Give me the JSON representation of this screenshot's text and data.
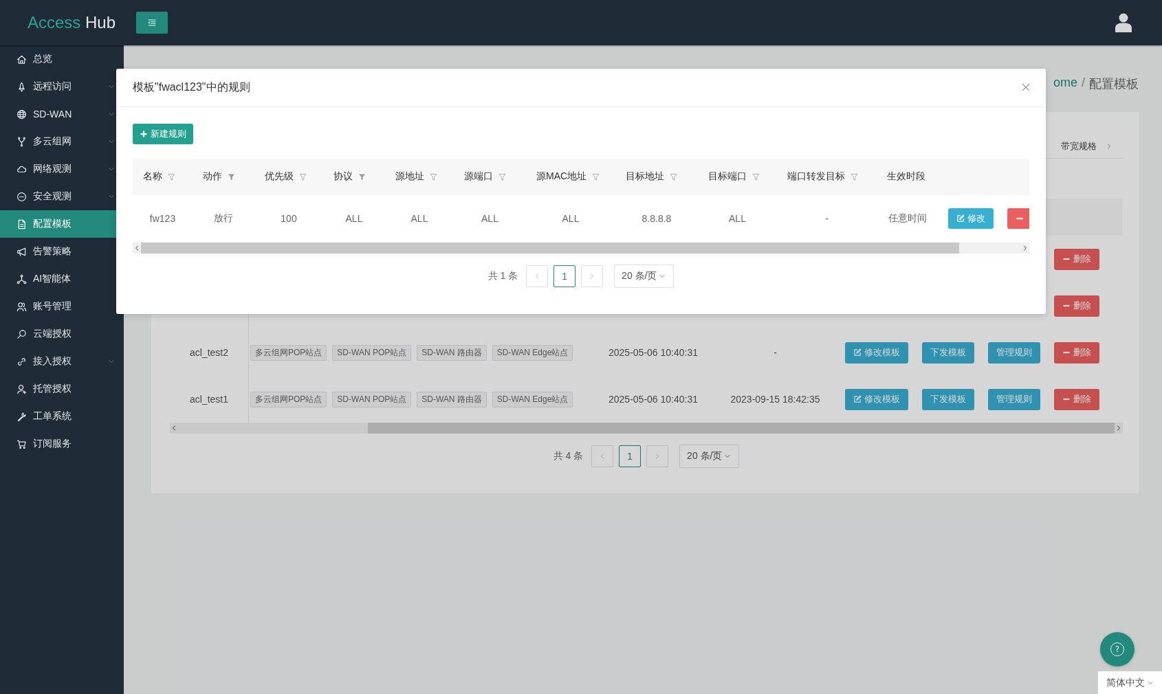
{
  "header": {
    "logo_primary": "Access",
    "logo_secondary": "Hub"
  },
  "sidebar": {
    "items": [
      {
        "label": "总览",
        "submenu": false,
        "selected": false
      },
      {
        "label": "远程访问",
        "submenu": true,
        "selected": false
      },
      {
        "label": "SD-WAN",
        "submenu": true,
        "selected": false
      },
      {
        "label": "多云组网",
        "submenu": true,
        "selected": false
      },
      {
        "label": "网络观测",
        "submenu": true,
        "selected": false
      },
      {
        "label": "安全观测",
        "submenu": true,
        "selected": false
      },
      {
        "label": "配置模板",
        "submenu": false,
        "selected": true
      },
      {
        "label": "告警策略",
        "submenu": false,
        "selected": false
      },
      {
        "label": "AI智能体",
        "submenu": false,
        "selected": false
      },
      {
        "label": "账号管理",
        "submenu": false,
        "selected": false
      },
      {
        "label": "云端授权",
        "submenu": false,
        "selected": false
      },
      {
        "label": "接入授权",
        "submenu": true,
        "selected": false
      },
      {
        "label": "托管授权",
        "submenu": false,
        "selected": false
      },
      {
        "label": "工单系统",
        "submenu": false,
        "selected": false
      },
      {
        "label": "订阅服务",
        "submenu": false,
        "selected": false
      }
    ]
  },
  "page": {
    "breadcrumb": [
      {
        "label": "ome",
        "link": true
      },
      {
        "label": "配置模板",
        "link": false
      }
    ],
    "separator": "/"
  },
  "tab_bar": {
    "tabs": [
      "带宽规格"
    ]
  },
  "templates_table": {
    "rows": [
      {
        "actions": [
          {
            "label": "删除",
            "kind": "danger"
          }
        ]
      },
      {
        "actions": [
          {
            "label": "删除",
            "kind": "danger"
          }
        ]
      },
      {
        "name": "acl_test2",
        "tags": [
          "多云组网POP站点",
          "SD-WAN POP站点",
          "SD-WAN 路由器",
          "SD-WAN Edge站点"
        ],
        "created": "2025-05-06 10:40:31",
        "updated": "-",
        "actions": [
          {
            "label": "修改模板",
            "kind": "edit"
          },
          {
            "label": "下发模板",
            "kind": "primary"
          },
          {
            "label": "管理规则",
            "kind": "primary"
          },
          {
            "label": "删除",
            "kind": "danger"
          }
        ]
      },
      {
        "name": "acl_test1",
        "tags": [
          "多云组网POP站点",
          "SD-WAN POP站点",
          "SD-WAN 路由器",
          "SD-WAN Edge站点"
        ],
        "created": "2025-05-06 10:40:31",
        "updated": "2023-09-15 18:42:35",
        "actions": [
          {
            "label": "修改模板",
            "kind": "edit"
          },
          {
            "label": "下发模板",
            "kind": "primary"
          },
          {
            "label": "管理规则",
            "kind": "primary"
          },
          {
            "label": "删除",
            "kind": "danger"
          }
        ]
      }
    ]
  },
  "templates_pagination": {
    "total": "共 4 条",
    "pages": [
      {
        "label": "1",
        "selected": true
      }
    ],
    "page_size": "20 条/页"
  },
  "modal": {
    "title": "模板\"fwacl123\"中的规则",
    "new_button": "新建规则",
    "columns": [
      {
        "label": "名称",
        "filtered": false
      },
      {
        "label": "动作",
        "filtered": true
      },
      {
        "label": "优先级",
        "filtered": false
      },
      {
        "label": "协议",
        "filtered": true
      },
      {
        "label": "源地址",
        "filtered": false
      },
      {
        "label": "源端口",
        "filtered": false
      },
      {
        "label": "源MAC地址",
        "filtered": false
      },
      {
        "label": "目标地址",
        "filtered": false
      },
      {
        "label": "目标端口",
        "filtered": false
      },
      {
        "label": "端口转发目标",
        "filtered": false
      },
      {
        "label": "生效时段"
      }
    ],
    "rows": [
      {
        "cells": [
          "fw123",
          "放行",
          "100",
          "ALL",
          "ALL",
          "ALL",
          "ALL",
          "8.8.8.8",
          "ALL",
          "-",
          "任意时间"
        ],
        "actions": [
          {
            "label": "修改",
            "kind": "edit"
          },
          {
            "kind": "danger"
          }
        ]
      }
    ],
    "pagination": {
      "total": "共 1 条",
      "pages": [
        {
          "label": "1",
          "selected": true
        }
      ],
      "page_size": "20 条/页"
    }
  },
  "help_button": {
    "label": "?"
  },
  "language": {
    "value": "简体中文"
  }
}
